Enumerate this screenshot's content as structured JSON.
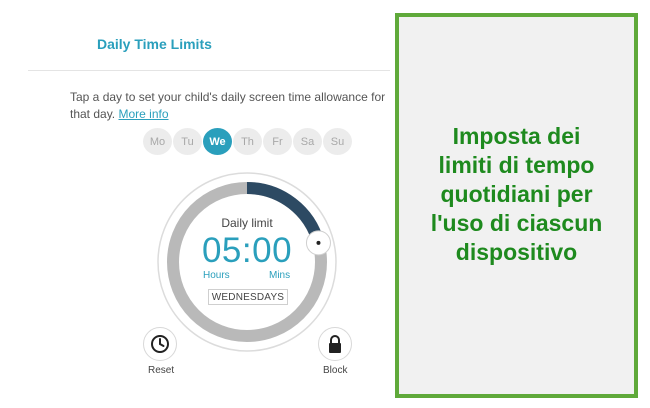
{
  "header": {
    "title": "Daily Time Limits"
  },
  "description": {
    "text": "Tap a day to set your child's daily screen time allowance for that day.",
    "link": "More info"
  },
  "days": [
    {
      "label": "Mo",
      "selected": false
    },
    {
      "label": "Tu",
      "selected": false
    },
    {
      "label": "We",
      "selected": true
    },
    {
      "label": "Th",
      "selected": false
    },
    {
      "label": "Fr",
      "selected": false
    },
    {
      "label": "Sa",
      "selected": false
    },
    {
      "label": "Su",
      "selected": false
    }
  ],
  "dial": {
    "label": "Daily limit",
    "time": "05:00",
    "hours_label": "Hours",
    "mins_label": "Mins",
    "day": "WEDNESDAYS",
    "fill_fraction": 0.2083,
    "colors": {
      "filled": "#2d4a63",
      "track": "#b9b9b9",
      "accent": "#2a9fbc"
    }
  },
  "actions": {
    "reset": {
      "label": "Reset",
      "icon": "clock-icon"
    },
    "block": {
      "label": "Block",
      "icon": "lock-icon"
    }
  },
  "callout": {
    "lines": [
      "Imposta dei",
      "limiti di tempo",
      "quotidiani per",
      "l'uso di ciascun",
      "dispositivo"
    ],
    "colors": {
      "text": "#1e8a1e",
      "border": "#5fa93a",
      "background": "#f1f1f1"
    }
  }
}
